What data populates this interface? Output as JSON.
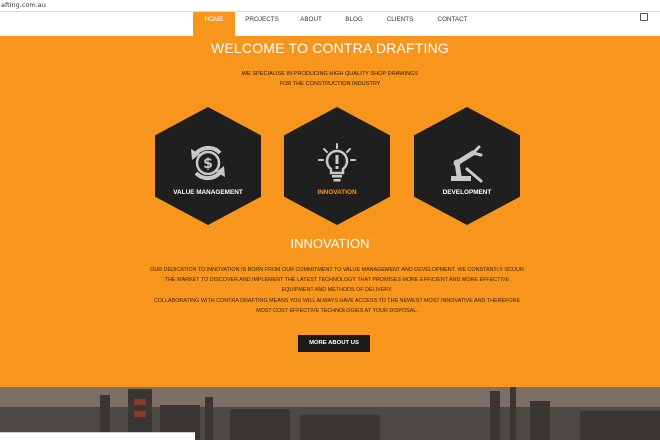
{
  "browser": {
    "url": "afting.com.au"
  },
  "nav": {
    "items": [
      "HOME",
      "PROJECTS",
      "ABOUT",
      "BLOG",
      "CLIENTS",
      "CONTACT"
    ],
    "active": "HOME"
  },
  "hero": {
    "title": "WELCOME TO CONTRA DRAFTING",
    "subtitle_line1": "WE SPECIALISE IN PRODUCING HIGH QUALITY SHOP DRAWINGS",
    "subtitle_line2": "FOR THE CONSTRUCTION INDUSTRY"
  },
  "services": [
    {
      "label": "VALUE MANAGEMENT",
      "icon": "dollar-cycle-icon"
    },
    {
      "label": "INNOVATION",
      "icon": "lightbulb-icon"
    },
    {
      "label": "DEVELOPMENT",
      "icon": "robot-arm-icon"
    }
  ],
  "section": {
    "title": "INNOVATION",
    "p1": "OUR DEDICATION TO INNOVATION IS BORN FROM OUR COMMITMENT TO VALUE MANAGEMENT AND DEVELOPMENT. WE CONSTANTLY SCOUR THE MARKET TO DISCOVER AND IMPLEMENT THE LATEST TECHNOLOGY THAT PROMISES MORE EFFICIENT AND MORE EFFECTIVE EQUIPMENT AND METHODS OF DELIVERY.",
    "p2": "COLLABORATING WITH CONTRA DRAFTING MEANS YOU WILL ALWAYS HAVE ACCESS TO THE NEWEST MOST INNOVATIVE AND THEREFORE MOST COST EFFECTIVE TECHNOLOGIES AT YOUR DISPOSAL.",
    "button": "MORE ABOUT US"
  },
  "colors": {
    "accent": "#f7951d",
    "dark": "#1f1f1f"
  }
}
